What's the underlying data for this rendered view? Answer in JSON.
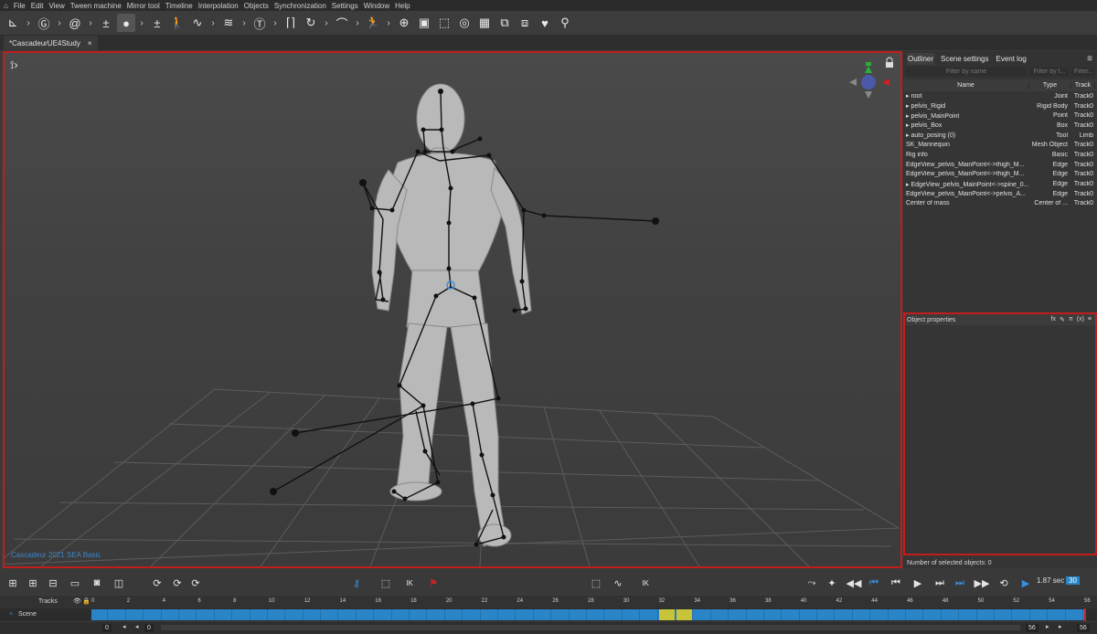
{
  "menu": [
    "File",
    "Edit",
    "View",
    "Tween machine",
    "Mirror tool",
    "Timeline",
    "Interpolation",
    "Objects",
    "Synchronization",
    "Settings",
    "Window",
    "Help"
  ],
  "toolbar_icons": [
    "select-tool-icon",
    "chevron-icon",
    "group-tool-icon",
    "chevron-icon",
    "spiral-tool-icon",
    "chevron-icon",
    "plus-minus-icon",
    "dot-tool-icon",
    "chevron-icon",
    "plus-minus-icon",
    "walk-icon",
    "curve-tool-icon",
    "chevron-icon",
    "wave-tool-icon",
    "chevron-icon",
    "text-tool-icon",
    "chevron-icon",
    "bracket-tool-icon",
    "loop-tool-icon",
    "chevron-icon",
    "arc-tool-icon",
    "chevron-icon",
    "run-icon",
    "chevron-icon",
    "target-icon",
    "camera-icon",
    "frame-icon",
    "swirl-icon",
    "grid-icon",
    "copy-icon",
    "paste-icon",
    "heart-shield-icon",
    "pose-icon"
  ],
  "document_tab": {
    "title": "*CascadeurUE4Study",
    "close": "×"
  },
  "viewport": {
    "watermark": "Cascadeur 2021 SEA Basic"
  },
  "outliner": {
    "tabs": [
      "Outliner",
      "Scene settings",
      "Event log"
    ],
    "menu_icon": "hamburger-icon",
    "filters": {
      "name": "Filter by name",
      "type": "Filter by t...",
      "track": "Filter..."
    },
    "columns": [
      "Name",
      "Type",
      "Track"
    ],
    "rows": [
      {
        "name": "▸ root",
        "type": "Joint",
        "track": "Track0"
      },
      {
        "name": "▸ pelvis_Rigid",
        "type": "Rigid Body",
        "track": "Track0"
      },
      {
        "name": "▸ pelvis_MainPoint",
        "type": "Point",
        "track": "Track0"
      },
      {
        "name": "▸ pelvis_Box",
        "type": "Box",
        "track": "Track0"
      },
      {
        "name": "▸ auto_posing (0)",
        "type": "Tool",
        "track": "Limb"
      },
      {
        "name": "SK_Mannequin",
        "type": "Mesh Object",
        "track": "Track0"
      },
      {
        "name": "Rig info",
        "type": "Basic",
        "track": "Track0"
      },
      {
        "name": "EdgeView_pelvis_MainPoint<->thigh_M...",
        "type": "Edge",
        "track": "Track0"
      },
      {
        "name": "EdgeView_pelvis_MainPoint<->thigh_M...",
        "type": "Edge",
        "track": "Track0"
      },
      {
        "name": "▸ EdgeView_pelvis_MainPoint<->spine_0...",
        "type": "Edge",
        "track": "Track0"
      },
      {
        "name": "EdgeView_pelvis_MainPoint<->pelvis_A...",
        "type": "Edge",
        "track": "Track0"
      },
      {
        "name": "Center of mass",
        "type": "Center of ...",
        "track": "Track0"
      }
    ]
  },
  "object_properties": {
    "title": "Object properties",
    "icons": [
      "fx",
      "✎",
      "π",
      "(x)",
      "≡"
    ]
  },
  "selection": {
    "label": "Number of selected objects: 0"
  },
  "playback": {
    "time": "1.87 sec",
    "fps_badge": "30",
    "ik_label": "IK",
    "ik_label2": "IK"
  },
  "timeline": {
    "tracks_label": "Tracks",
    "scene_label": "Scene",
    "frame_ticks": [
      "0",
      "2",
      "4",
      "6",
      "8",
      "10",
      "12",
      "14",
      "16",
      "18",
      "20",
      "22",
      "24",
      "26",
      "28",
      "30",
      "32",
      "34",
      "36",
      "38",
      "40",
      "42",
      "44",
      "46",
      "48",
      "50",
      "52",
      "54",
      "56"
    ],
    "end_frame": "56",
    "start_field": "0",
    "start_field2": "0",
    "end_field": "56",
    "end_field2": "56",
    "highlight_frame": 32
  },
  "colors": {
    "accent_red": "#c21d1d",
    "track_blue": "#2a84c8",
    "highlight_yellow": "#c8c43a",
    "watermark_blue": "#3e86c8"
  }
}
